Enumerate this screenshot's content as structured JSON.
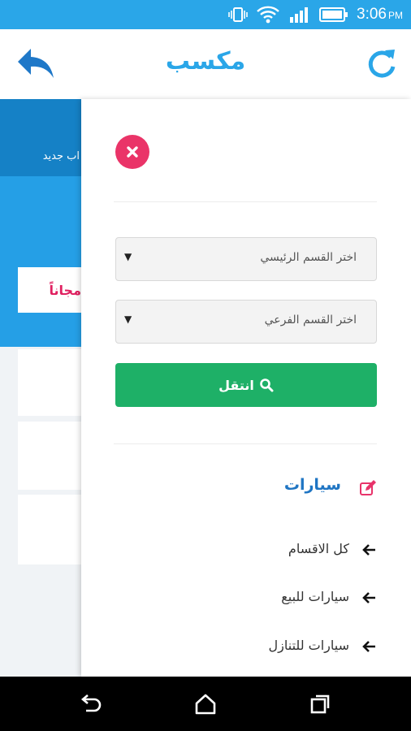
{
  "status_bar": {
    "time": "3:06",
    "ampm": "PM",
    "background": "#2aa6e8"
  },
  "app_bar": {
    "title": "مكسب",
    "back_icon": "back-arrow-icon",
    "refresh_icon": "refresh-icon",
    "accent": "#2aa6e8"
  },
  "background_screen": {
    "new_account": "اب جديد",
    "free_label": "مجاناً"
  },
  "drawer": {
    "main_category": {
      "placeholder": "اختر القسم الرئيسي"
    },
    "sub_category": {
      "placeholder": "اختر القسم الفرعي"
    },
    "go_button": {
      "label": "انتقل",
      "color": "#1eb067"
    },
    "category": {
      "title": "سيارات",
      "icon": "edit-icon"
    },
    "items": [
      {
        "label": "كل الاقسام"
      },
      {
        "label": "سيارات للبيع"
      },
      {
        "label": "سيارات للتنازل"
      }
    ]
  }
}
